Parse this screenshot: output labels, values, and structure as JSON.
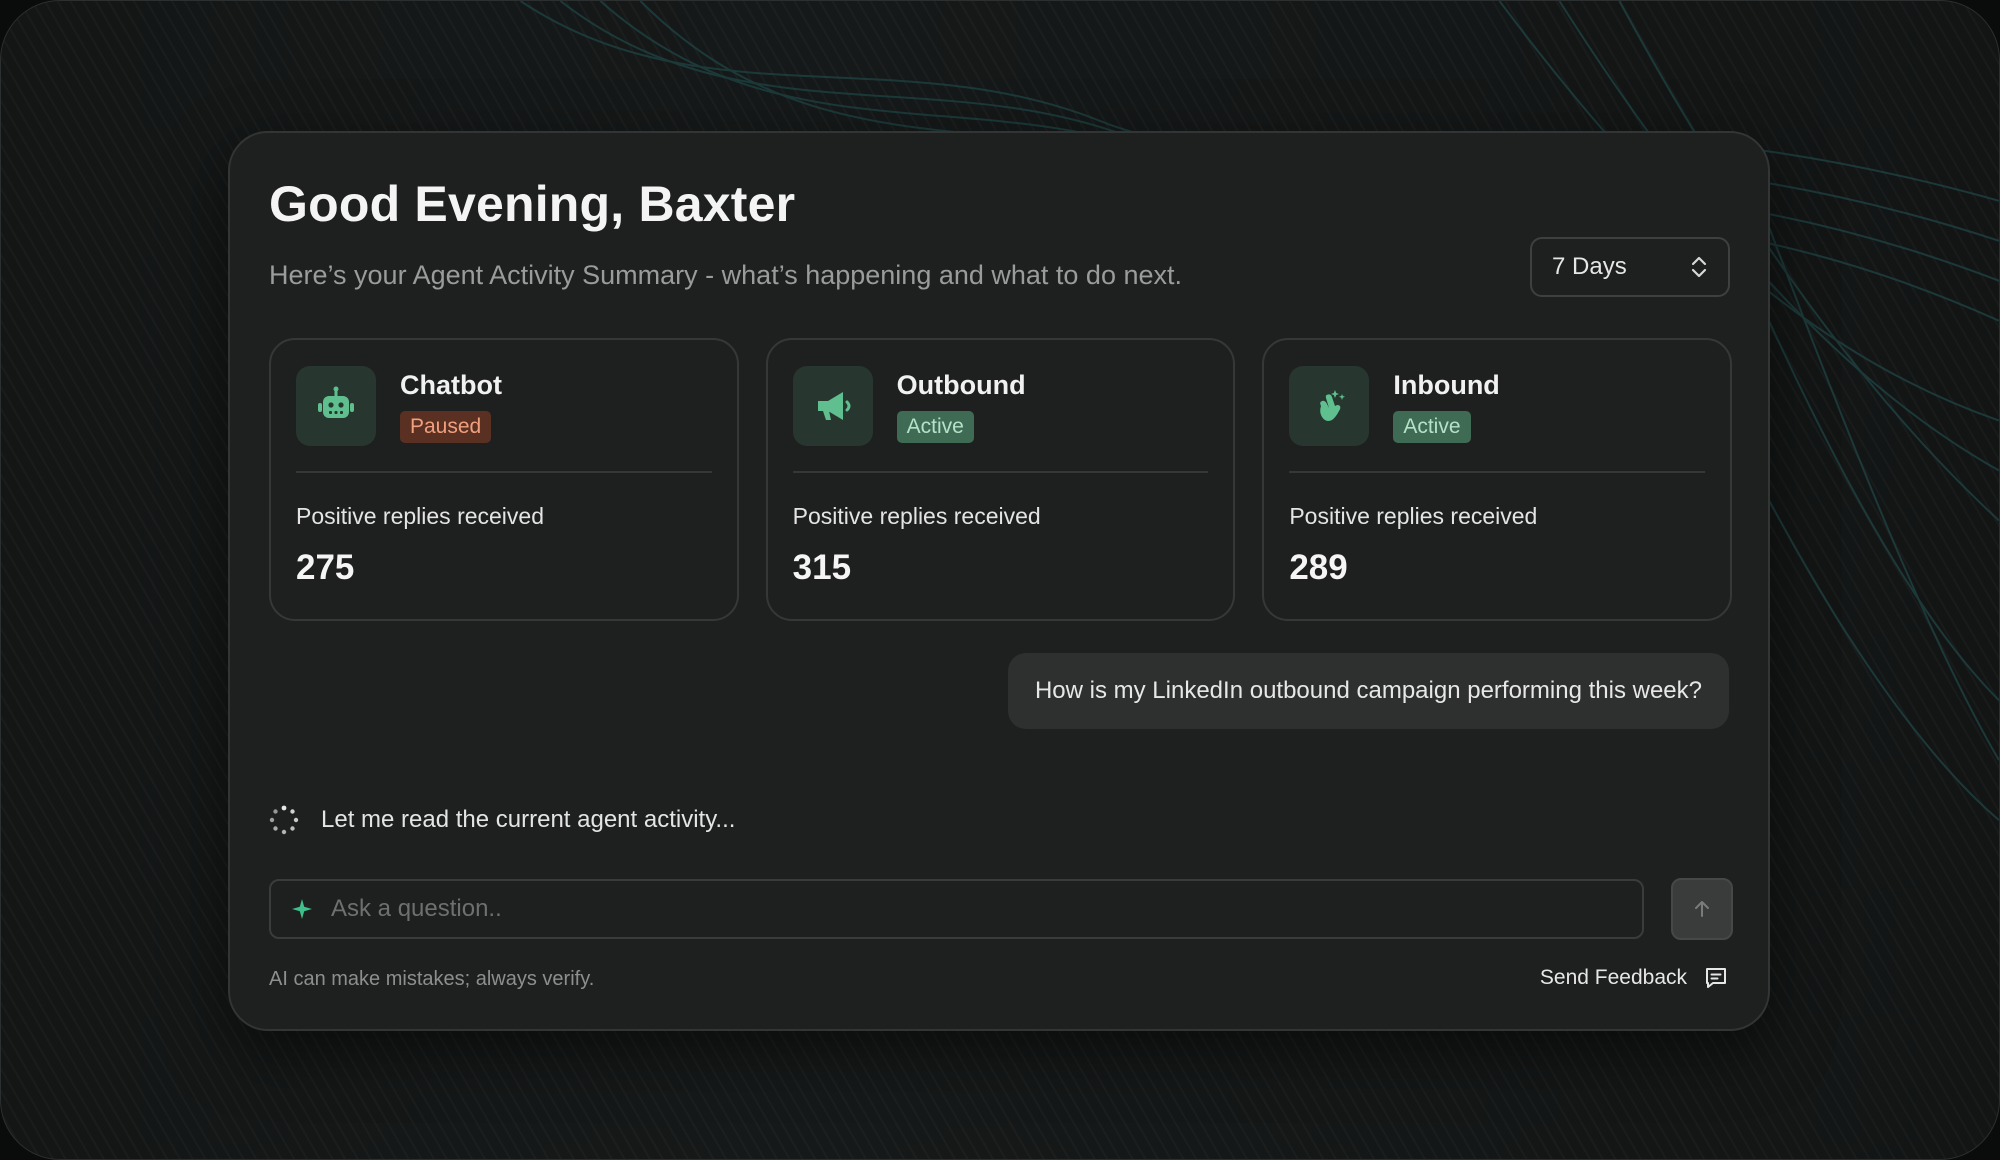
{
  "header": {
    "greeting": "Good Evening, Baxter",
    "subtitle": "Here’s your Agent Activity Summary - what’s happening and what to do next."
  },
  "range_select": {
    "value": "7 Days"
  },
  "agents": [
    {
      "name": "Chatbot",
      "status": "Paused",
      "metric_label": "Positive replies received",
      "metric_value": "275",
      "icon": "robot-icon"
    },
    {
      "name": "Outbound",
      "status": "Active",
      "metric_label": "Positive replies received",
      "metric_value": "315",
      "icon": "megaphone-icon"
    },
    {
      "name": "Inbound",
      "status": "Active",
      "metric_label": "Positive replies received",
      "metric_value": "289",
      "icon": "hand-wave-icon"
    }
  ],
  "chat": {
    "user_message": "How is my LinkedIn outbound campaign performing this week?",
    "ai_status": "Let me read the current agent activity..."
  },
  "input": {
    "placeholder": "Ask a question.."
  },
  "footer": {
    "disclaimer": "AI can make mistakes; always verify.",
    "feedback_label": "Send Feedback"
  },
  "colors": {
    "accent_green": "#5fbf8f",
    "paused_bg": "#5a3022",
    "paused_text": "#f0a07e",
    "active_bg": "#3f6a54",
    "active_text": "#b6e0c8"
  }
}
